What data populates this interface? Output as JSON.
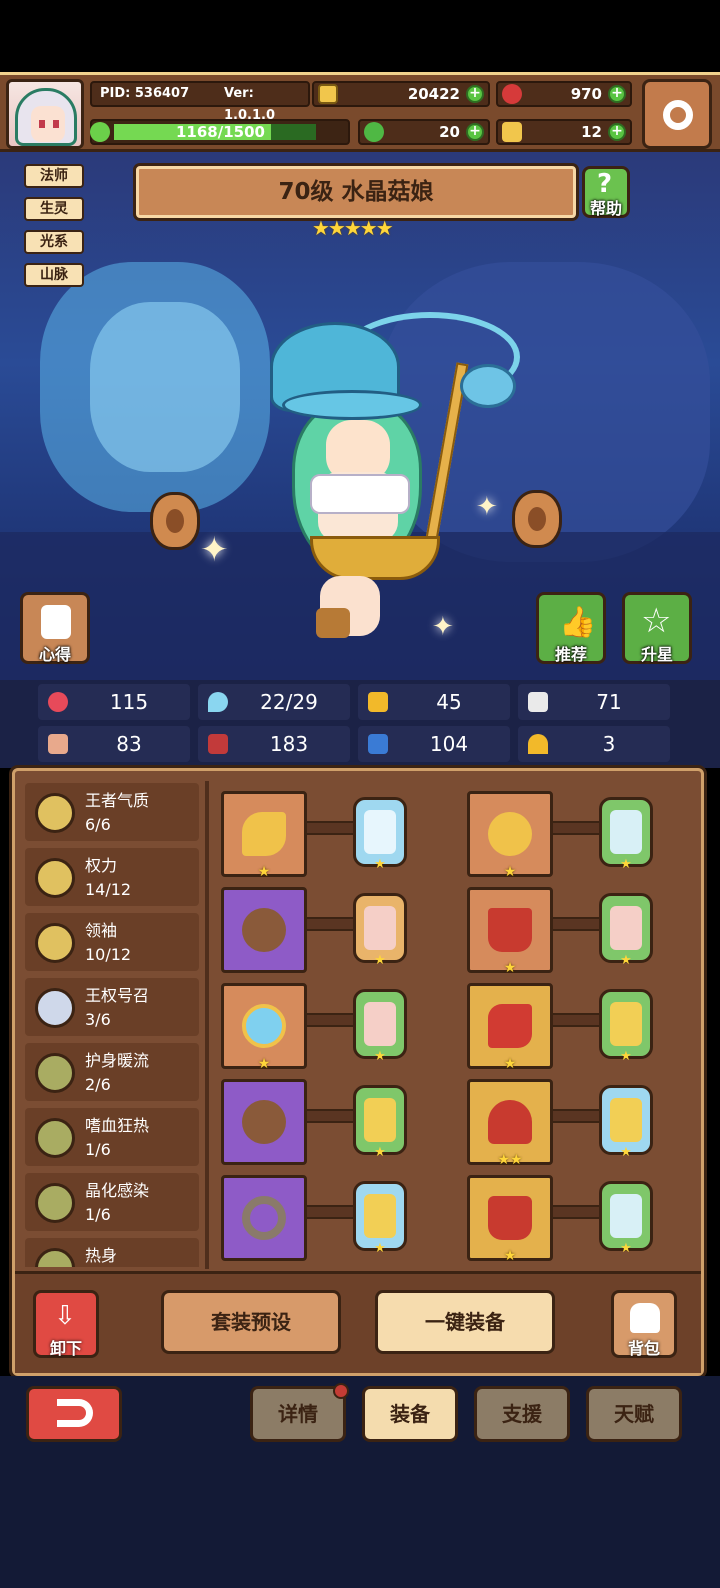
{
  "header": {
    "pid": "PID: 536407",
    "version": "Ver: 1.0.1.0",
    "gold": "20422",
    "gems": "970",
    "clover": "20",
    "tickets": "12",
    "exp": "1168/1500",
    "exp_progress": 0.779
  },
  "scene": {
    "tags": [
      "法师",
      "生灵",
      "光系",
      "山脉"
    ],
    "title": "70级 水晶菇娘",
    "stars": "★★★★★",
    "help_label": "帮助",
    "notes_label": "心得",
    "recommend_label": "推荐",
    "upgrade_label": "升星"
  },
  "stats": [
    {
      "icon": "heart-icon",
      "value": "115"
    },
    {
      "icon": "drop-icon",
      "value": "22/29"
    },
    {
      "icon": "shield-icon",
      "value": "45"
    },
    {
      "icon": "wing-icon",
      "value": "71"
    },
    {
      "icon": "fist-icon",
      "value": "83"
    },
    {
      "icon": "book-icon",
      "value": "183"
    },
    {
      "icon": "boot-icon",
      "value": "104"
    },
    {
      "icon": "horseshoe-icon",
      "value": "3"
    }
  ],
  "sets": [
    {
      "name": "王者气质",
      "count": "6/6"
    },
    {
      "name": "权力",
      "count": "14/12"
    },
    {
      "name": "领袖",
      "count": "10/12"
    },
    {
      "name": "王权号召",
      "count": "3/6"
    },
    {
      "name": "护身暖流",
      "count": "2/6"
    },
    {
      "name": "嗜血狂热",
      "count": "1/6"
    },
    {
      "name": "晶化感染",
      "count": "1/6"
    },
    {
      "name": "热身",
      "count": ""
    }
  ],
  "equipment": {
    "left": [
      {
        "item": "staff-icon",
        "stars": "★",
        "gem_stars": "★"
      },
      {
        "item": "shield-round-icon",
        "stars": "",
        "gem_stars": "★"
      },
      {
        "item": "amulet-icon",
        "stars": "★",
        "gem_stars": "★"
      },
      {
        "item": "shield-round-icon",
        "stars": "",
        "gem_stars": "★"
      },
      {
        "item": "ring-icon",
        "stars": "",
        "gem_stars": "★"
      }
    ],
    "right": [
      {
        "item": "ring-gold-icon",
        "stars": "★",
        "gem_stars": "★"
      },
      {
        "item": "cape-icon",
        "stars": "★",
        "gem_stars": "★"
      },
      {
        "item": "glove-icon",
        "stars": "★",
        "gem_stars": "★"
      },
      {
        "item": "belt-icon",
        "stars": "★★",
        "gem_stars": "★"
      },
      {
        "item": "boots-icon",
        "stars": "★",
        "gem_stars": "★"
      }
    ]
  },
  "buttons": {
    "unequip": "卸下",
    "preset": "套装预设",
    "auto_equip": "一键装备",
    "bag": "背包"
  },
  "nav": {
    "details": "详情",
    "equip": "装备",
    "support": "支援",
    "talent": "天赋"
  }
}
